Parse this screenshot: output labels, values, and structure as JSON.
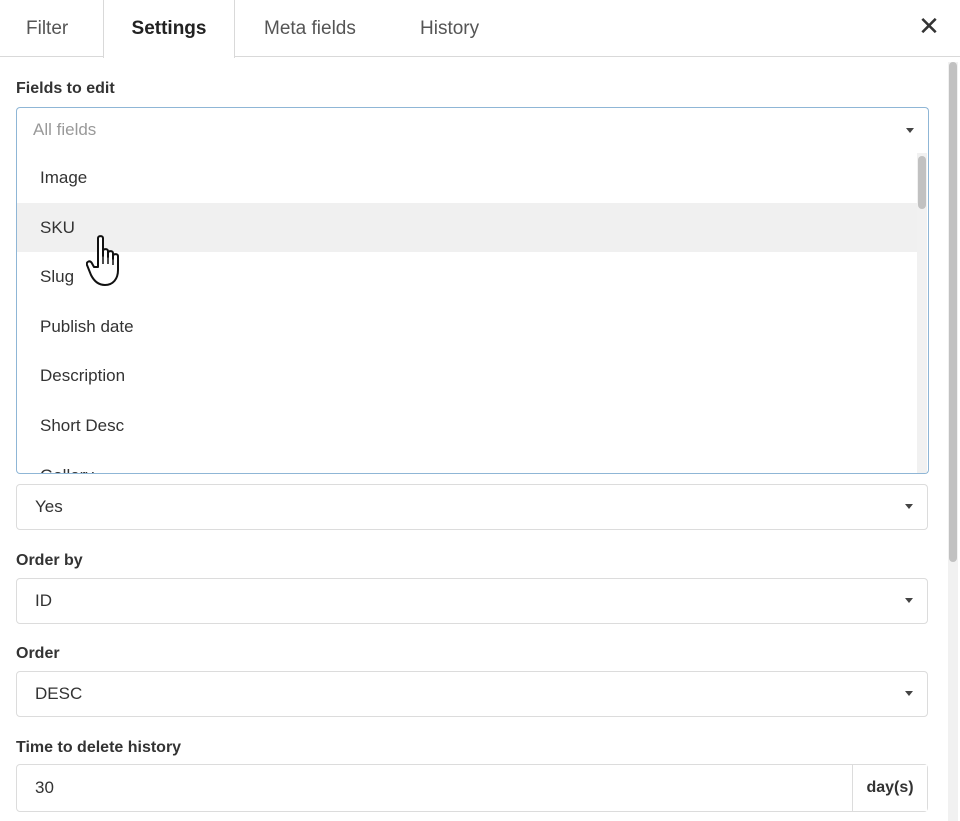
{
  "tabs": [
    {
      "label": "Filter",
      "active": false
    },
    {
      "label": "Settings",
      "active": true
    },
    {
      "label": "Meta fields",
      "active": false
    },
    {
      "label": "History",
      "active": false
    }
  ],
  "close_label": "✕",
  "fields_to_edit": {
    "label": "Fields to edit",
    "placeholder": "All fields",
    "options": [
      "Image",
      "SKU",
      "Slug",
      "Publish date",
      "Description",
      "Short Desc",
      "Gallery"
    ],
    "hovered_option": "SKU"
  },
  "setting_yes": {
    "value": "Yes"
  },
  "order_by": {
    "label": "Order by",
    "value": "ID"
  },
  "order": {
    "label": "Order",
    "value": "DESC"
  },
  "time_to_delete_history": {
    "label": "Time to delete history",
    "value": "30",
    "unit": "day(s)"
  },
  "icons": {
    "close": "close-icon",
    "caret": "caret-down-icon",
    "cursor": "hand-pointer-icon"
  }
}
